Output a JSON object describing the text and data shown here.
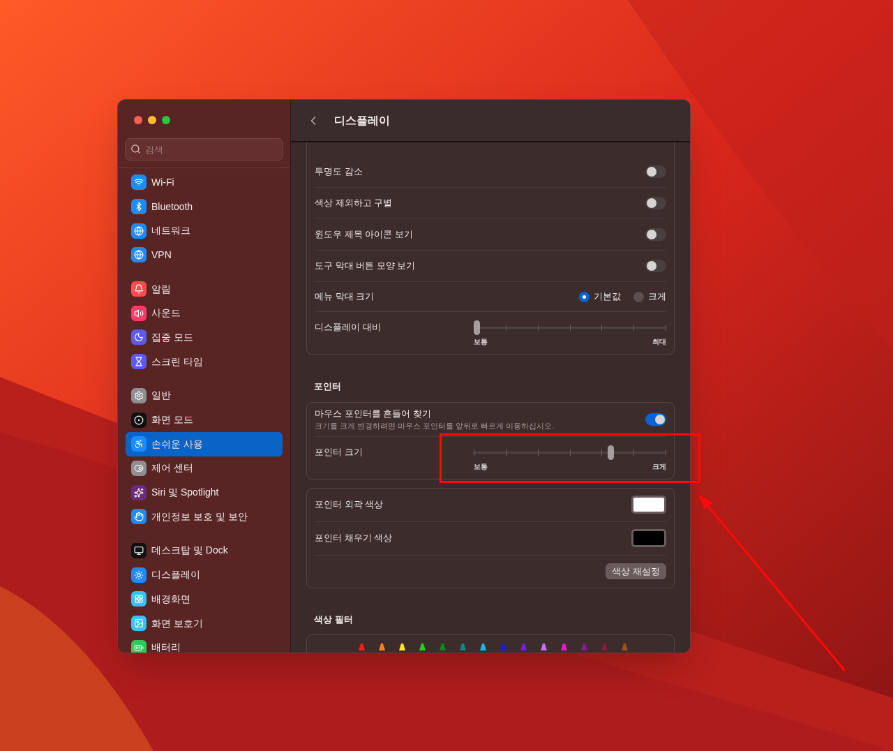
{
  "window": {
    "title": "디스플레이"
  },
  "search": {
    "placeholder": "검색"
  },
  "sidebar": {
    "groups": [
      {
        "items": [
          {
            "label": "Wi-Fi",
            "selected": false
          },
          {
            "label": "Bluetooth",
            "selected": false
          },
          {
            "label": "네트워크",
            "selected": false
          },
          {
            "label": "VPN",
            "selected": false
          }
        ]
      },
      {
        "items": [
          {
            "label": "알림",
            "selected": false
          },
          {
            "label": "사운드",
            "selected": false
          },
          {
            "label": "집중 모드",
            "selected": false
          },
          {
            "label": "스크린 타임",
            "selected": false
          }
        ]
      },
      {
        "items": [
          {
            "label": "일반",
            "selected": false
          },
          {
            "label": "화면 모드",
            "selected": false
          },
          {
            "label": "손쉬운 사용",
            "selected": true
          },
          {
            "label": "제어 센터",
            "selected": false
          },
          {
            "label": "Siri 및 Spotlight",
            "selected": false
          },
          {
            "label": "개인정보 보호 및 보안",
            "selected": false
          }
        ]
      },
      {
        "items": [
          {
            "label": "데스크탑 및 Dock",
            "selected": false
          },
          {
            "label": "디스플레이",
            "selected": false
          },
          {
            "label": "배경화면",
            "selected": false
          },
          {
            "label": "화면 보호기",
            "selected": false
          },
          {
            "label": "배터리",
            "selected": false
          }
        ]
      }
    ]
  },
  "display_card": [
    {
      "kind": "toggle",
      "label": "투명도 감소",
      "on": false
    },
    {
      "kind": "toggle",
      "label": "색상 제외하고 구별",
      "on": false
    },
    {
      "kind": "toggle",
      "label": "윈도우 제목 아이콘 보기",
      "on": false
    },
    {
      "kind": "toggle",
      "label": "도구 막대 버튼 모양 보기",
      "on": false
    },
    {
      "kind": "radio",
      "label": "메뉴 막대 크기",
      "options": [
        {
          "label": "기본값",
          "selected": true
        },
        {
          "label": "크게",
          "selected": false
        }
      ]
    },
    {
      "kind": "slider",
      "label": "디스플레이 대비",
      "level": 0,
      "min_label": "보통",
      "max_label": "최대"
    }
  ],
  "pointer": {
    "heading": "포인터",
    "rows": [
      {
        "kind": "toggle",
        "label": "마우스 포인터를 흔들어 찾기",
        "description": "크기를 크게 변경하려면 마우스 포인터를 앞뒤로 빠르게 이동하십시오.",
        "on": true
      },
      {
        "kind": "slider",
        "label": "포인터 크기",
        "level": 0.72,
        "min_label": "보통",
        "max_label": "크게"
      }
    ]
  },
  "pointer_colors": {
    "rows": [
      {
        "label": "포인터 외곽 색상",
        "color": "#ffffff"
      },
      {
        "label": "포인터 채우기 색상",
        "color": "#000000"
      }
    ],
    "reset_button": "색상 재설정"
  },
  "color_filter": {
    "heading": "색상 필터"
  }
}
